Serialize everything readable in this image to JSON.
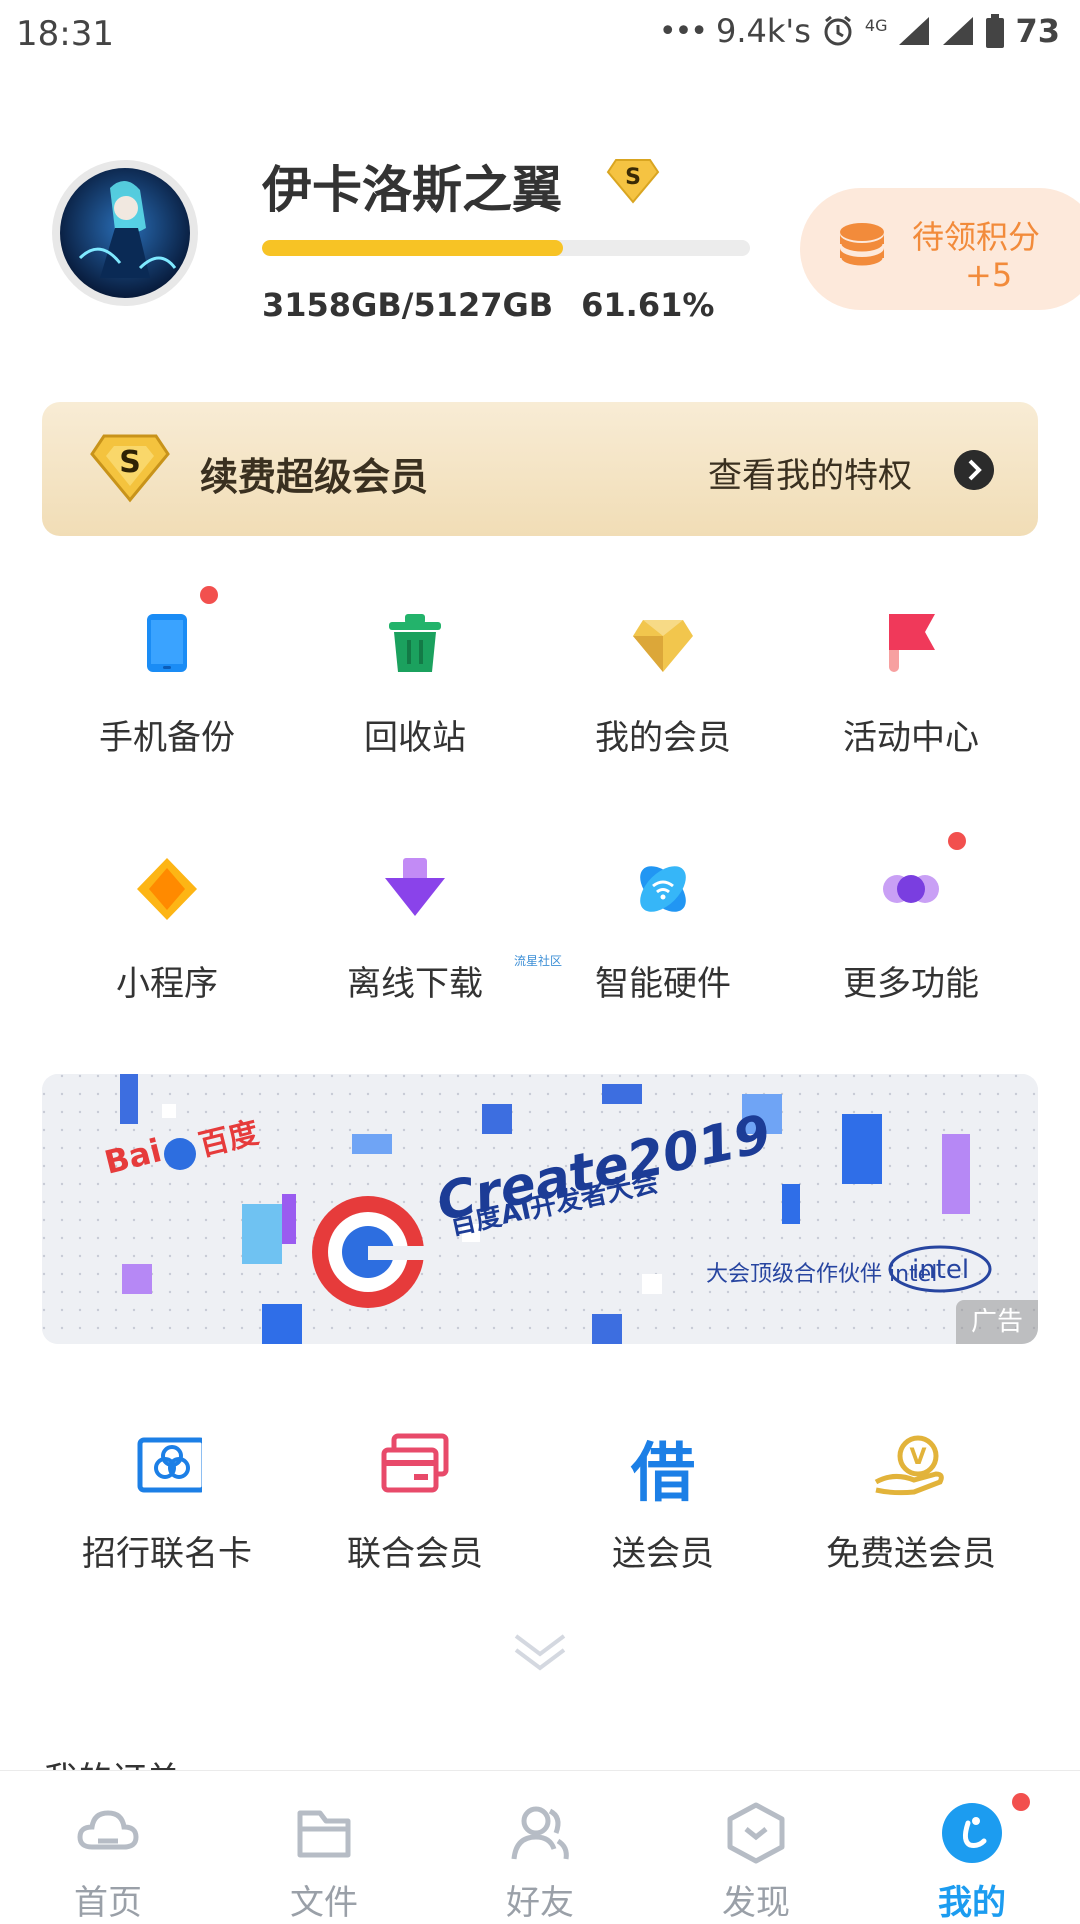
{
  "status_bar": {
    "time": "18:31",
    "speed": "9.4k's",
    "network": "4G",
    "battery": "73"
  },
  "profile": {
    "username": "伊卡洛斯之翼",
    "vip_badge": "S",
    "storage_used_fraction": 0.6161,
    "storage_text": "3158GB/5127GB",
    "storage_percent": "61.61%"
  },
  "points": {
    "label": "待领积分",
    "value": "+5"
  },
  "renew": {
    "title": "续费超级会员",
    "link": "查看我的特权"
  },
  "grid_rows": [
    [
      {
        "label": "手机备份",
        "icon": "phone-icon"
      },
      {
        "label": "回收站",
        "icon": "trash-icon"
      },
      {
        "label": "我的会员",
        "icon": "diamond-icon"
      },
      {
        "label": "活动中心",
        "icon": "flag-icon"
      }
    ],
    [
      {
        "label": "小程序",
        "icon": "mini-program-icon"
      },
      {
        "label": "离线下载",
        "icon": "download-icon"
      },
      {
        "label": "智能硬件",
        "icon": "smart-hardware-icon"
      },
      {
        "label": "更多功能",
        "icon": "more-icon"
      }
    ]
  ],
  "tiny_note": "流星社区",
  "ad": {
    "brand": "Bai百度",
    "headline": "Create2019",
    "subtitle": "百度AI开发者大会",
    "partner": "大会顶级合作伙伴 intel",
    "tag": "广告"
  },
  "promos": [
    {
      "label": "招行联名卡",
      "icon": "bank-card-icon"
    },
    {
      "label": "联合会员",
      "icon": "card-icon"
    },
    {
      "label": "送会员",
      "icon": "borrow-icon",
      "glyph": "借"
    },
    {
      "label": "免费送会员",
      "icon": "hand-coin-icon"
    }
  ],
  "orders_peek": "我的订单",
  "tabbar": [
    {
      "label": "首页",
      "icon": "cloud-icon",
      "active": false
    },
    {
      "label": "文件",
      "icon": "folder-icon",
      "active": false
    },
    {
      "label": "好友",
      "icon": "friends-icon",
      "active": false
    },
    {
      "label": "发现",
      "icon": "discover-icon",
      "active": false
    },
    {
      "label": "我的",
      "icon": "me-icon",
      "active": true
    }
  ],
  "colors": {
    "accent_blue": "#1c9cf0",
    "progress_yellow": "#f7c325",
    "points_orange": "#f28b3b",
    "dot_red": "#f2504e"
  }
}
